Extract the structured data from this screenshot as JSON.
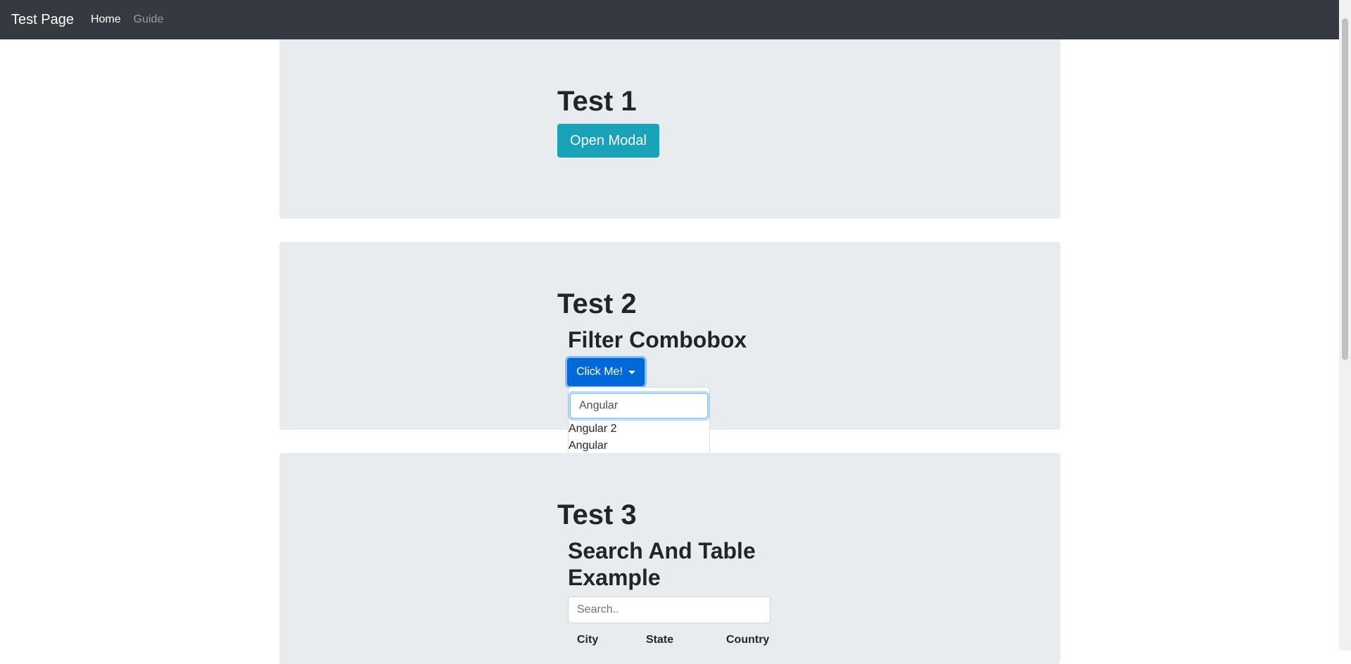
{
  "navbar": {
    "brand": "Test Page",
    "links": [
      {
        "label": "Home",
        "active": true
      },
      {
        "label": "Guide",
        "active": false
      }
    ]
  },
  "test1": {
    "title": "Test 1",
    "button_label": "Open Modal"
  },
  "test2": {
    "title": "Test 2",
    "subtitle": "Filter Combobox",
    "button_label": "Click Me!",
    "filter_value": "Angular",
    "options": [
      "Angular 2",
      "Angular"
    ]
  },
  "test3": {
    "title": "Test 3",
    "subtitle_line1": "Search And Table",
    "subtitle_line2": "Example",
    "search_placeholder": "Search..",
    "columns": [
      "City",
      "State",
      "Country"
    ]
  },
  "colors": {
    "navbar_bg": "#343a40",
    "jumbotron_bg": "#e9ecef",
    "info_button": "#17a2b8",
    "primary_button": "#0069d9"
  }
}
